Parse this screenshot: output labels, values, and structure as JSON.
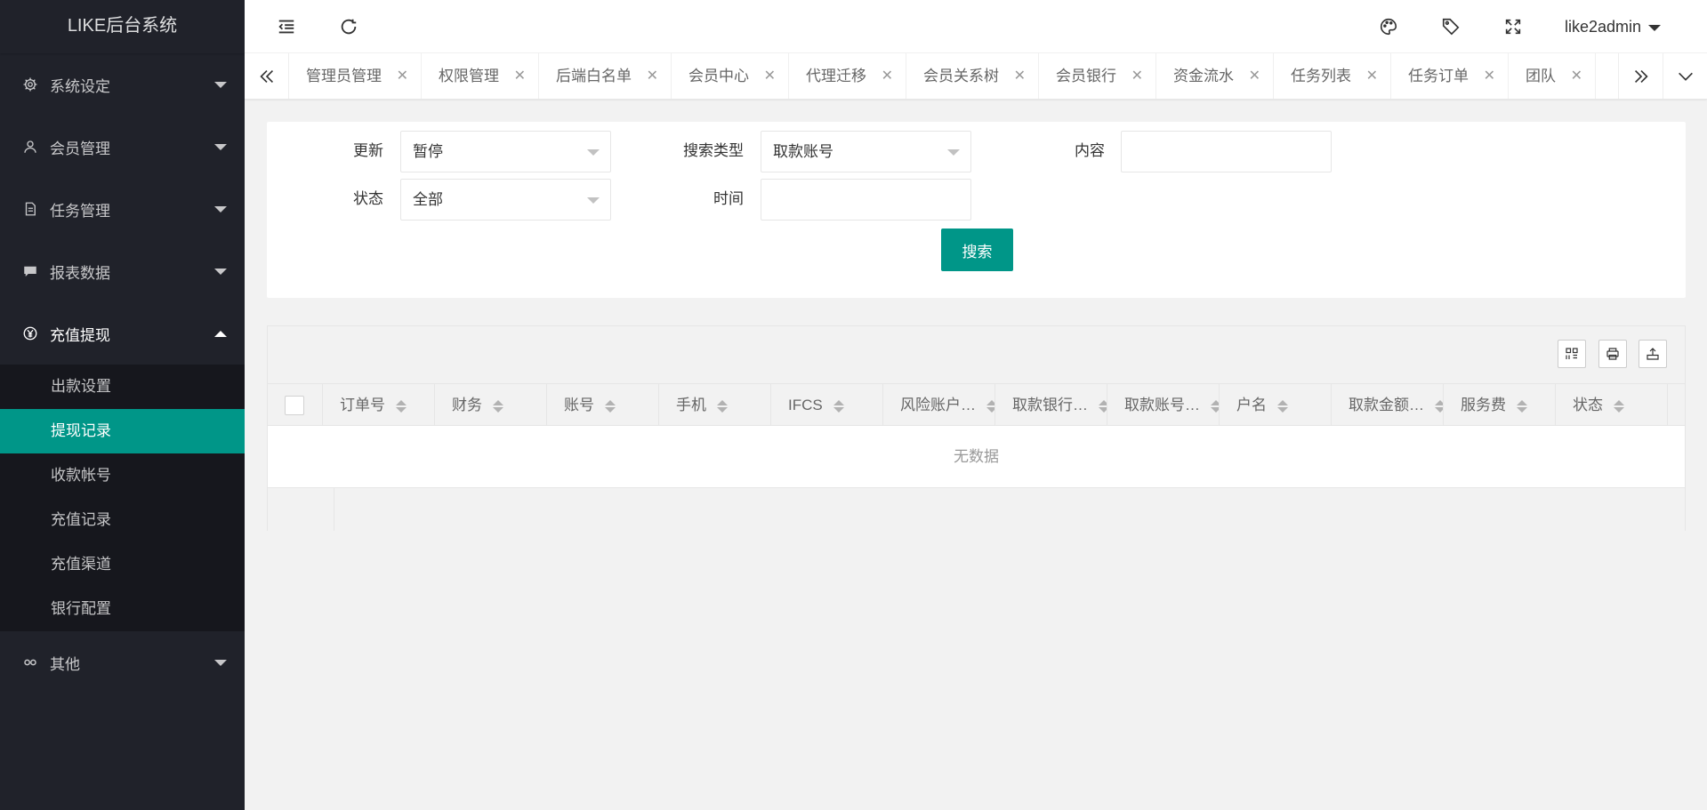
{
  "app": {
    "title": "LIKE后台系统"
  },
  "sidebar": {
    "items": [
      {
        "label": "系统设定",
        "icon": "gear-icon"
      },
      {
        "label": "会员管理",
        "icon": "user-icon"
      },
      {
        "label": "任务管理",
        "icon": "file-icon"
      },
      {
        "label": "报表数据",
        "icon": "chat-icon"
      },
      {
        "label": "充值提现",
        "icon": "yen-icon"
      },
      {
        "label": "其他",
        "icon": "link-icon"
      }
    ],
    "submenu": [
      "出款设置",
      "提现记录",
      "收款帐号",
      "充值记录",
      "充值渠道",
      "银行配置"
    ],
    "active_sub": "提现记录"
  },
  "header": {
    "user": "like2admin"
  },
  "tabs": [
    "管理员管理",
    "权限管理",
    "后端白名单",
    "会员中心",
    "代理迁移",
    "会员关系树",
    "会员银行",
    "资金流水",
    "任务列表",
    "任务订单",
    "团队"
  ],
  "search": {
    "update_label": "更新",
    "update_value": "暂停",
    "type_label": "搜索类型",
    "type_value": "取款账号",
    "content_label": "内容",
    "content_value": "",
    "status_label": "状态",
    "status_value": "全部",
    "time_label": "时间",
    "time_value": "",
    "button": "搜索"
  },
  "table": {
    "columns": [
      "订单号",
      "财务",
      "账号",
      "手机",
      "IFCS",
      "风险账户…",
      "取款银行…",
      "取款账号…",
      "户名",
      "取款金额…",
      "服务费",
      "状态"
    ],
    "empty": "无数据"
  },
  "colors": {
    "accent": "#009688",
    "sidebar": "#20222a"
  }
}
